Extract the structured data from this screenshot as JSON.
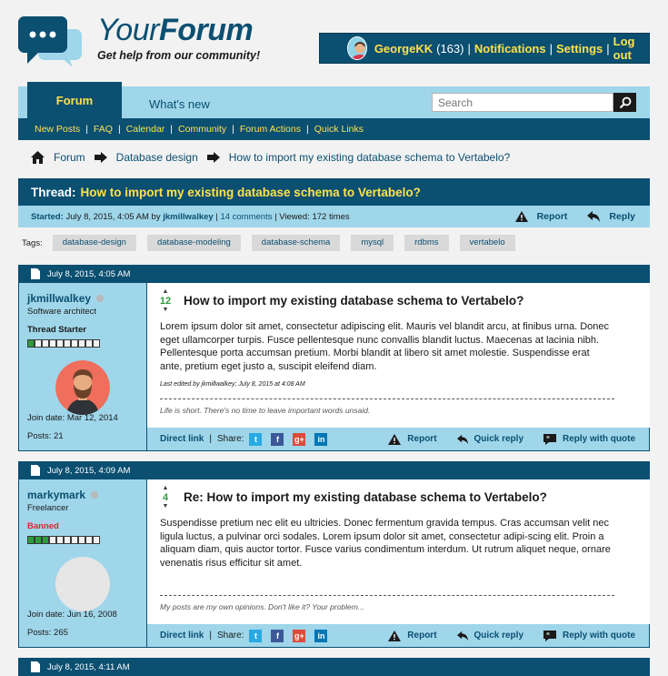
{
  "header": {
    "title_part1": "Your",
    "title_part2": "Forum",
    "tagline": "Get help from our community!"
  },
  "user": {
    "name": "GeorgeKK",
    "count": "(163)",
    "notifications": "Notifications",
    "settings": "Settings",
    "logout": "Log out"
  },
  "nav": {
    "tabs": [
      {
        "label": "Forum"
      },
      {
        "label": "What's new"
      }
    ],
    "search_placeholder": "Search",
    "sub": [
      "New Posts",
      "FAQ",
      "Calendar",
      "Community",
      "Forum Actions",
      "Quick Links"
    ]
  },
  "breadcrumb": [
    "Forum",
    "Database design",
    "How to import my existing database schema to Vertabelo?"
  ],
  "thread": {
    "prefix": "Thread:",
    "title": "How to import my existing database schema to Vertabelo?",
    "started_label": "Started:",
    "started_date": "July 8, 2015, 4:05 AM by",
    "author": "jkmillwalkey",
    "comments": "14 comments",
    "viewed": "Viewed: 172 times",
    "report": "Report",
    "reply": "Reply"
  },
  "tags": {
    "label": "Tags:",
    "items": [
      "database-design",
      "database-modeling",
      "database-schema",
      "mysql",
      "rdbms",
      "vertabelo"
    ]
  },
  "posts": [
    {
      "date": "July 8, 2015, 4:05 AM",
      "username": "jkmillwalkey",
      "role": "Software architect",
      "status": "Thread Starter",
      "reputation": 0.1,
      "join": "Join date: Mar 12, 2014",
      "posts": "Posts: 21",
      "votes": "12",
      "title": "How to import my existing database schema to Vertabelo?",
      "text": "Lorem ipsum dolor sit amet, consectetur adipiscing elit. Mauris vel blandit arcu, at finibus urna. Donec eget ullamcorper turpis. Fusce pellentesque nunc convallis blandit luctus. Maecenas at lacinia nibh. Pellentesque porta accumsan pretium. Morbi blandit at libero sit amet molestie. Suspendisse erat ante, pretium eget justo a, suscipit eleifend diam.",
      "edited": "Last edited by jkmillwalkey; July 8, 2015 at 4:08 AM",
      "signature": "Life is short. There's no time to leave important words unsaid."
    },
    {
      "date": "July 8, 2015, 4:09 AM",
      "username": "markymark",
      "role": "Freelancer",
      "status": "Banned",
      "reputation": 0.3,
      "join": "Join date: Jun 16, 2008",
      "posts": "Posts: 265",
      "votes": "4",
      "title": "Re: How to import my existing database schema to Vertabelo?",
      "text": "Suspendisse pretium nec elit eu ultricies. Donec fermentum gravida tempus. Cras accumsan velit nec ligula luctus, a pulvinar orci sodales. Lorem ipsum dolor sit amet, consectetur adipi-scing elit. Proin a aliquam diam, quis auctor tortor. Fusce varius condimentum interdum. Ut rutrum aliquet neque, ornare venenatis risus efficitur sit amet.",
      "edited": "",
      "signature": "My posts are my own opinions. Don't like it? Your problem..."
    }
  ],
  "third_post_date": "July 8, 2015, 4:11 AM",
  "post_footer": {
    "direct_link": "Direct link",
    "share": "Share:",
    "report": "Report",
    "quick_reply": "Quick reply",
    "reply_quote": "Reply with quote"
  },
  "colors": {
    "primary": "#0b4f71",
    "accent": "#ffe14d",
    "light": "#9fd6ea",
    "banned": "#e0262a",
    "rep": "#2e9c3c"
  }
}
